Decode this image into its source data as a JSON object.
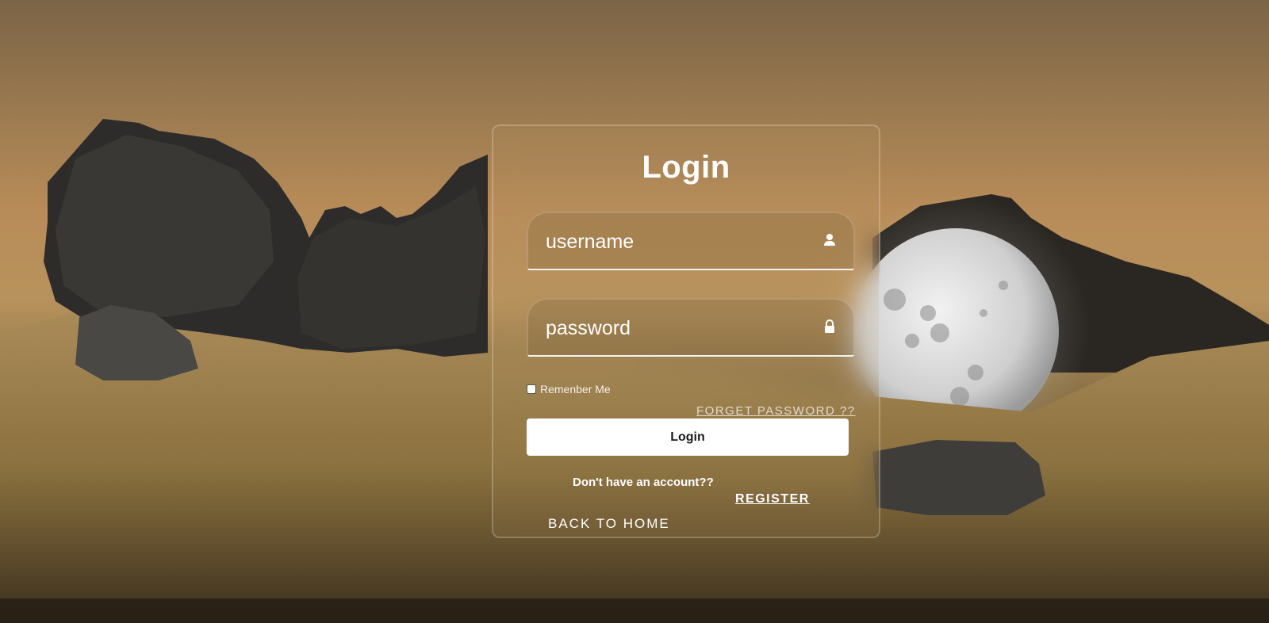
{
  "login_card": {
    "title": "Login",
    "username": {
      "placeholder": "username",
      "icon": "user-icon"
    },
    "password": {
      "placeholder": "password",
      "icon": "lock-icon"
    },
    "remember_label": "Remenber Me",
    "forgot_link": "FORGET PASSWORD ??",
    "login_button": "Login",
    "no_account_text": "Don't have an account??",
    "register_link": "REGISTER",
    "back_home_link": "BACK TO HOME"
  },
  "theme": {
    "accent": "#ffffff",
    "background_sky": "#b88c58",
    "background_grass": "#8d7448"
  }
}
